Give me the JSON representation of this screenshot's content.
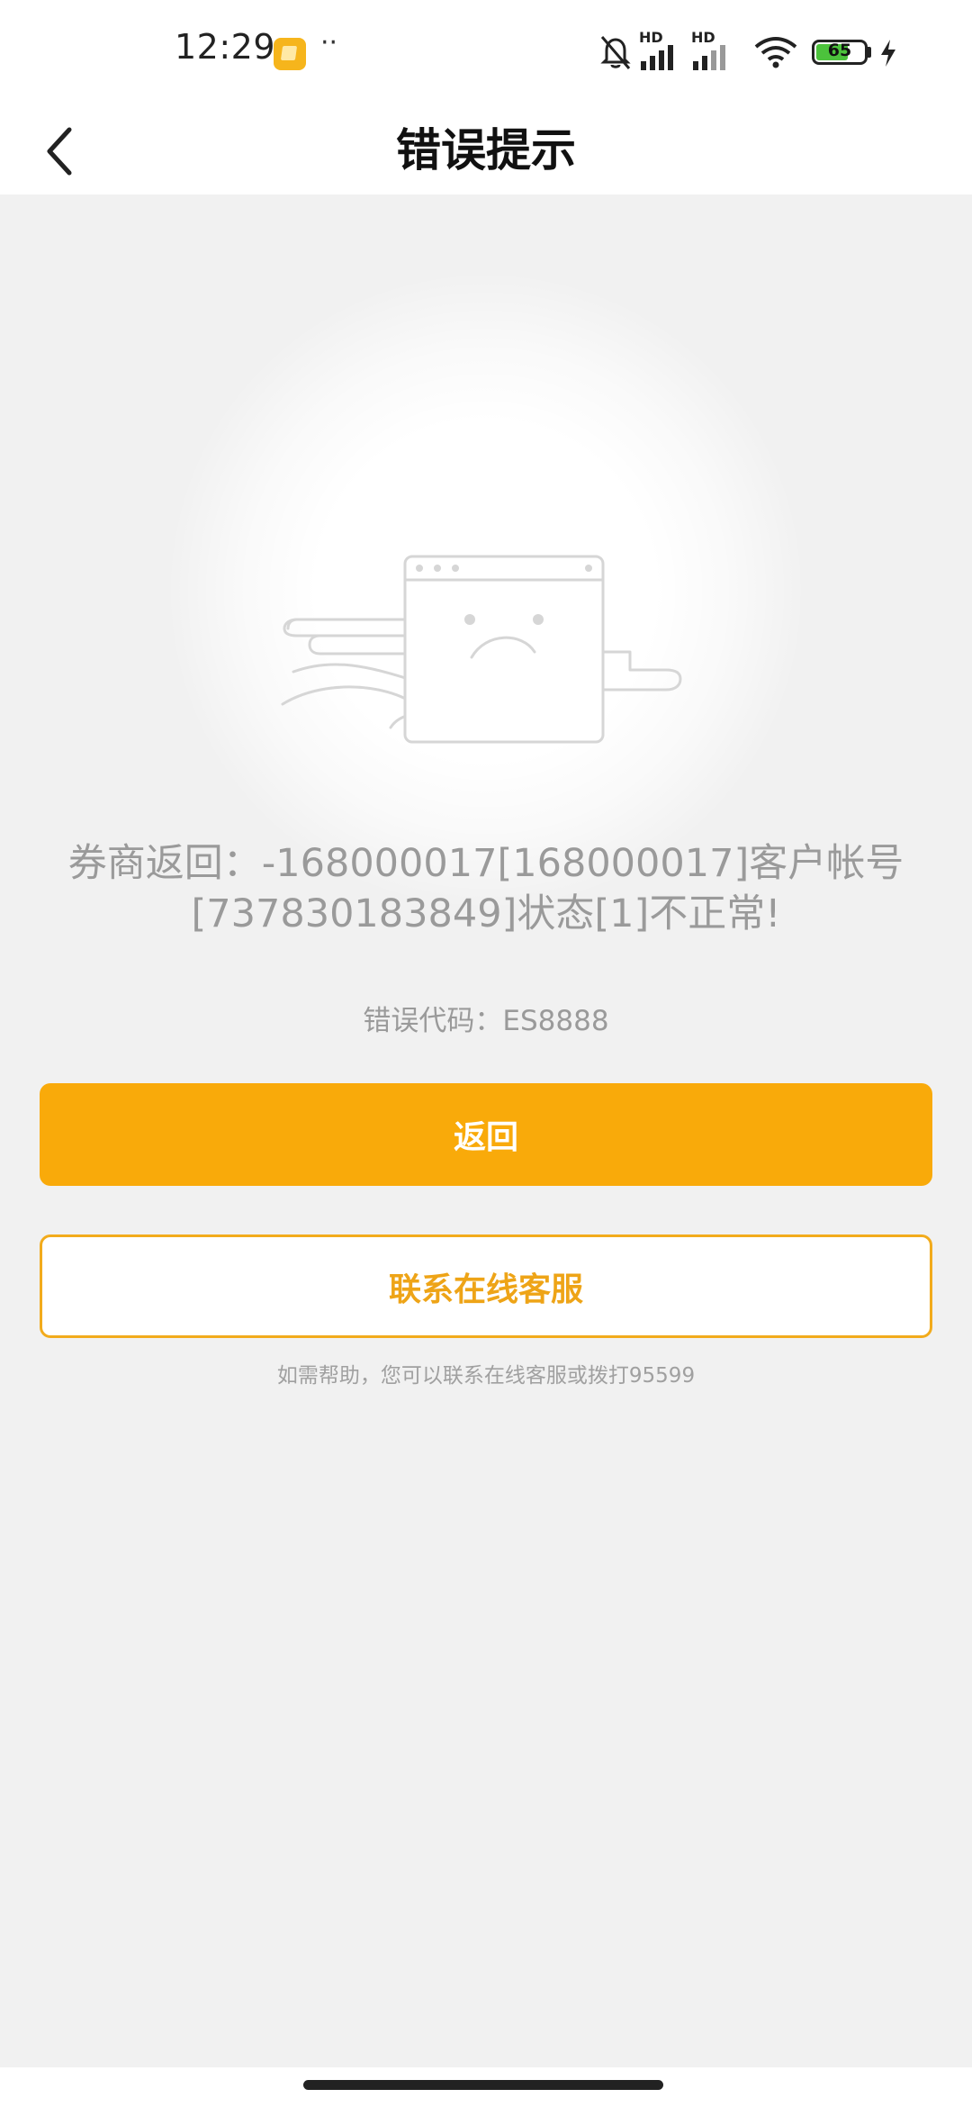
{
  "status_bar": {
    "time": "12:29",
    "hd_label_1": "HD",
    "hd_label_2": "HD",
    "battery_level": "65",
    "icons": [
      "app-notification-icon",
      "more-dots-icon",
      "mute-bell-icon",
      "signal-icon",
      "signal-icon",
      "wifi-icon",
      "battery-icon",
      "charging-icon"
    ]
  },
  "header": {
    "title": "错误提示"
  },
  "error": {
    "message": "券商返回：-168000017[168000017]客户帐号[737830183849]状态[1]不正常!",
    "code_line": "错误代码：ES8888"
  },
  "buttons": {
    "return_label": "返回",
    "contact_label": "联系在线客服"
  },
  "help_text": "如需帮助，您可以联系在线客服或拨打95599",
  "colors": {
    "accent": "#f9aa0a",
    "contact_text": "#eea417",
    "background": "#f1f1f1",
    "muted_text": "#9a9a9a"
  }
}
